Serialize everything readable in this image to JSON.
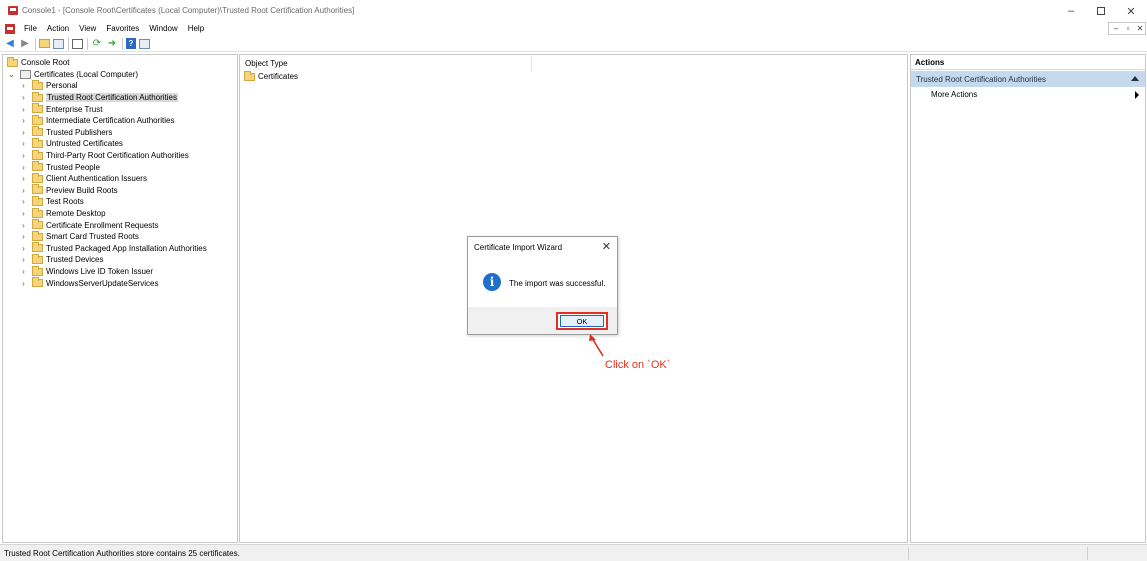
{
  "window": {
    "title": "Console1 - [Console Root\\Certificates (Local Computer)\\Trusted Root Certification Authorities]",
    "minimize": "–",
    "close": "✕"
  },
  "menubar": {
    "items": [
      "File",
      "Action",
      "View",
      "Favorites",
      "Window",
      "Help"
    ],
    "mdi_minimize": "–",
    "mdi_restore": "▫",
    "mdi_close": "✕"
  },
  "toolbar": {
    "back_icon": "arrow-left-icon",
    "forward_icon": "arrow-right-icon"
  },
  "tree": {
    "root": "Console Root",
    "certificates": "Certificates (Local Computer)",
    "stores": [
      "Personal",
      "Trusted Root Certification Authorities",
      "Enterprise Trust",
      "Intermediate Certification Authorities",
      "Trusted Publishers",
      "Untrusted Certificates",
      "Third-Party Root Certification Authorities",
      "Trusted People",
      "Client Authentication Issuers",
      "Preview Build Roots",
      "Test Roots",
      "Remote Desktop",
      "Certificate Enrollment Requests",
      "Smart Card Trusted Roots",
      "Trusted Packaged App Installation Authorities",
      "Trusted Devices",
      "Windows Live ID Token Issuer",
      "WindowsServerUpdateServices"
    ],
    "selected_index": 1
  },
  "middle": {
    "column_header": "Object Type",
    "items": [
      "Certificates"
    ]
  },
  "actions": {
    "header": "Actions",
    "selected": "Trusted Root Certification Authorities",
    "items": [
      "More Actions"
    ]
  },
  "status": {
    "text": "Trusted Root Certification Authorities store contains 25 certificates."
  },
  "dialog": {
    "title": "Certificate Import Wizard",
    "close": "✕",
    "message": "The import was successful.",
    "info_icon": "i",
    "ok_label": "OK"
  },
  "annotation": {
    "text": "Click on `OK`",
    "color": "#e0301e"
  }
}
